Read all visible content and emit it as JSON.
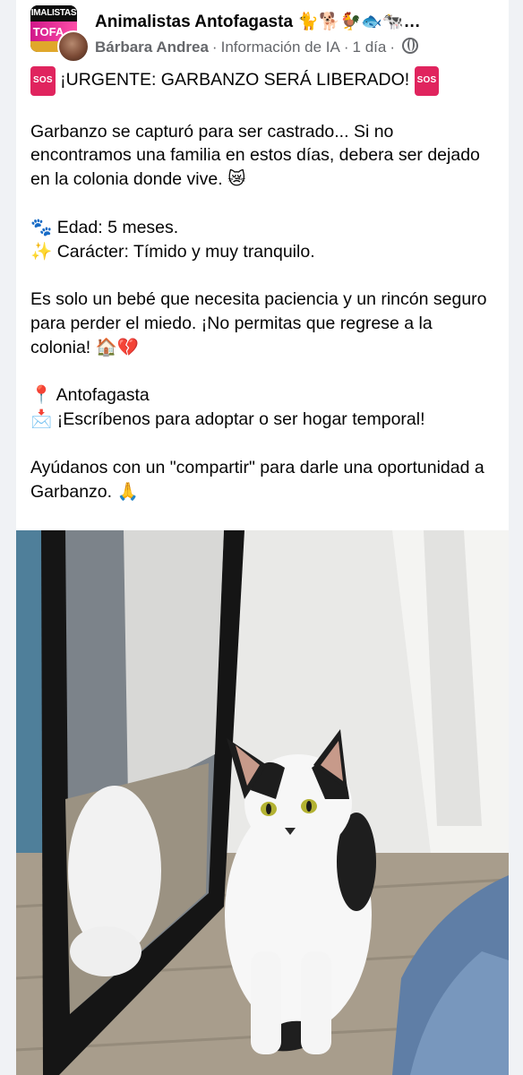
{
  "post": {
    "group_name": "Animalistas Antofagasta 🐈🐕🐓🐟🐄…",
    "author": "Bárbara Andrea",
    "separator": "·",
    "ai_info": "Información de IA",
    "time": "1 día",
    "avatar_text_top": "IMALISTAS",
    "avatar_text_bottom": "TOFA",
    "sos_label": "SOS",
    "title": "¡URGENTE: GARBANZO SERÁ LIBERADO!",
    "paragraph1": "Garbanzo se capturó para ser castrado... Si no encontramos una familia en estos días, debera ser dejado en la colonia donde vive. 😿",
    "age_icon": "🐾",
    "age_line": "Edad: 5 meses.",
    "character_icon": "✨",
    "character_line": "Carácter: Tímido y muy tranquilo.",
    "paragraph3": "Es solo un bebé que necesita paciencia y un rincón seguro para perder el miedo. ¡No permitas que regrese a la colonia! 🏠💔",
    "location_icon": "📍",
    "location": "Antofagasta",
    "contact_icon": "📩",
    "contact": "¡Escríbenos para adoptar o ser hogar temporal!",
    "closing": "Ayúdanos con un \"compartir\" para darle una oportunidad a Garbanzo. 🙏"
  },
  "icons": {
    "globe": "globe-icon"
  },
  "colors": {
    "sos_badge": "#e0245e",
    "secondary_text": "#65676b"
  }
}
